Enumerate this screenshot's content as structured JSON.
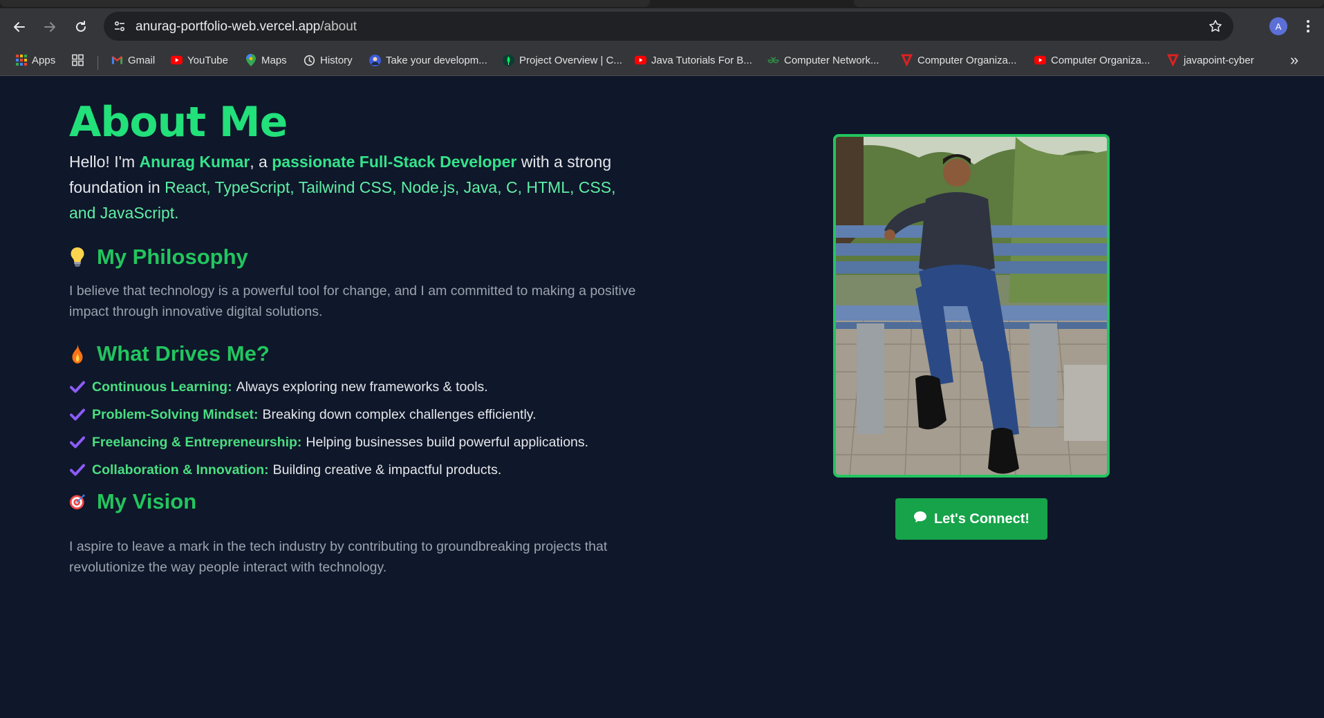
{
  "browser": {
    "url_host": "anurag-portfolio-web.vercel.app",
    "url_path": "/about",
    "avatar_letter": "A",
    "bookmarks": [
      {
        "label": "Apps",
        "icon": "apps-grid-icon"
      },
      {
        "label": "",
        "icon": "tab-groups-icon"
      },
      {
        "label": "Gmail",
        "icon": "gmail-icon"
      },
      {
        "label": "YouTube",
        "icon": "youtube-icon"
      },
      {
        "label": "Maps",
        "icon": "maps-icon"
      },
      {
        "label": "History",
        "icon": "history-icon"
      },
      {
        "label": "Take your developm...",
        "icon": "avatar-icon"
      },
      {
        "label": "Project Overview | C...",
        "icon": "mongodb-leaf-icon"
      },
      {
        "label": "Java Tutorials For B...",
        "icon": "youtube-icon"
      },
      {
        "label": "Computer Network...",
        "icon": "geeksforgeeks-icon"
      },
      {
        "label": "Computer Organiza...",
        "icon": "javatpoint-icon"
      },
      {
        "label": "Computer Organiza...",
        "icon": "youtube-icon"
      },
      {
        "label": "javapoint-cyber",
        "icon": "javatpoint-icon"
      }
    ],
    "overflow_label": "»"
  },
  "about": {
    "title": "About Me",
    "intro_hello": "Hello! I'm ",
    "intro_name": "Anurag Kumar",
    "intro_a": ", a ",
    "intro_role": "passionate Full-Stack Developer",
    "intro_mid": " with a strong foundation in ",
    "intro_tech": "React, TypeScript, Tailwind CSS, Node.js, Java, C, HTML, CSS, and JavaScript."
  },
  "philosophy": {
    "icon": "lightbulb-icon",
    "heading": "My Philosophy",
    "text": "I believe that technology is a powerful tool for change, and I am committed to making a positive impact through innovative digital solutions."
  },
  "drives": {
    "icon": "fire-icon",
    "heading": "What Drives Me?",
    "items": [
      {
        "label": "Continuous Learning:",
        "text": "Always exploring new frameworks & tools."
      },
      {
        "label": "Problem-Solving Mindset:",
        "text": "Breaking down complex challenges efficiently."
      },
      {
        "label": "Freelancing & Entrepreneurship:",
        "text": "Helping businesses build powerful applications."
      },
      {
        "label": "Collaboration & Innovation:",
        "text": "Building creative & impactful products."
      }
    ]
  },
  "vision": {
    "icon": "target-icon",
    "heading": "My Vision",
    "text": "I aspire to leave a mark in the tech industry by contributing to groundbreaking projects that revolutionize the way people interact with technology."
  },
  "cta": {
    "icon": "chat-bubble-icon",
    "label": "Let's Connect!"
  },
  "colors": {
    "page_bg": "#0f172a",
    "accent_green": "#22c55e",
    "title_green": "#22e07a",
    "check_purple": "#8b5cf6",
    "button_green": "#16a34a"
  }
}
